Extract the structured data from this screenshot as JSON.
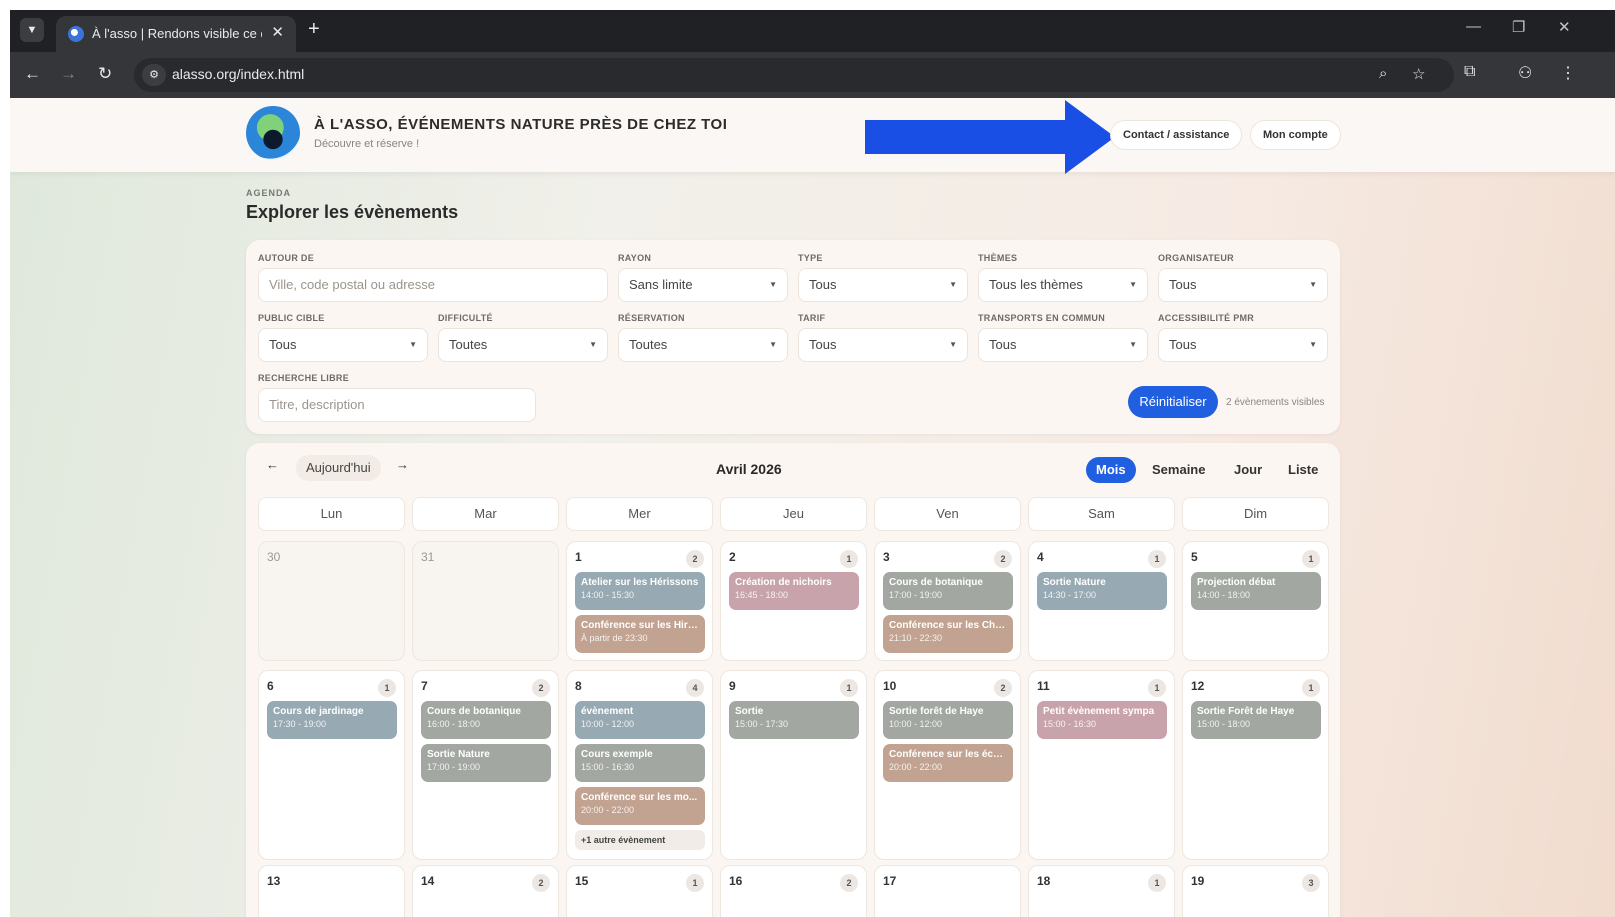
{
  "browser": {
    "tab_title": "À l'asso | Rendons visible ce qu",
    "url": "alasso.org/index.html"
  },
  "site": {
    "title": "À L'ASSO, ÉVÉNEMENTS NATURE PRÈS DE CHEZ TOI",
    "subtitle": "Découvre et réserve !",
    "contact_label": "Contact / assistance",
    "account_label": "Mon compte"
  },
  "agenda": {
    "eyebrow": "AGENDA",
    "title": "Explorer les évènements"
  },
  "filters": {
    "near": {
      "label": "AUTOUR DE",
      "placeholder": "Ville, code postal ou adresse"
    },
    "radius": {
      "label": "RAYON",
      "value": "Sans limite"
    },
    "type": {
      "label": "TYPE",
      "value": "Tous"
    },
    "themes": {
      "label": "THÈMES",
      "value": "Tous les thèmes"
    },
    "organizer": {
      "label": "ORGANISATEUR",
      "value": "Tous"
    },
    "audience": {
      "label": "PUBLIC CIBLE",
      "value": "Tous"
    },
    "difficulty": {
      "label": "DIFFICULTÉ",
      "value": "Toutes"
    },
    "booking": {
      "label": "RÉSERVATION",
      "value": "Toutes"
    },
    "price": {
      "label": "TARIF",
      "value": "Tous"
    },
    "transport": {
      "label": "TRANSPORTS EN COMMUN",
      "value": "Tous"
    },
    "accessibility": {
      "label": "ACCESSIBILITÉ PMR",
      "value": "Tous"
    },
    "search": {
      "label": "RECHERCHE LIBRE",
      "placeholder": "Titre, description"
    },
    "reset_label": "Réinitialiser",
    "visible_count": "2 évènements visibles"
  },
  "calendar": {
    "today_label": "Aujourd'hui",
    "prev_label": "←",
    "next_label": "→",
    "title": "Avril 2026",
    "views": [
      "Mois",
      "Semaine",
      "Jour",
      "Liste"
    ],
    "active_view": "Mois",
    "weekdays": [
      "Lun",
      "Mar",
      "Mer",
      "Jeu",
      "Ven",
      "Sam",
      "Dim"
    ],
    "colors": {
      "blue": "#97a9b2",
      "grey": "#a3a7a2",
      "pink": "#c9a3ab",
      "tan": "#c2a391",
      "reset": "#1f5fe0"
    },
    "weeks": [
      [
        {
          "num": "30",
          "muted": true,
          "events": []
        },
        {
          "num": "31",
          "muted": true,
          "events": []
        },
        {
          "num": "1",
          "count": "2",
          "events": [
            {
              "title": "Atelier sur les Hérissons",
              "time": "14:00 - 15:30",
              "color": "blue"
            },
            {
              "title": "Conférence sur les Hiro...",
              "time": "À partir de 23:30",
              "color": "tan"
            }
          ]
        },
        {
          "num": "2",
          "count": "1",
          "events": [
            {
              "title": "Création de nichoirs",
              "time": "16:45 - 18:00",
              "color": "pink"
            }
          ]
        },
        {
          "num": "3",
          "count": "2",
          "events": [
            {
              "title": "Cours de botanique",
              "time": "17:00 - 19:00",
              "color": "grey"
            },
            {
              "title": "Conférence sur les Cho...",
              "time": "21:10 - 22:30",
              "color": "tan"
            }
          ]
        },
        {
          "num": "4",
          "count": "1",
          "events": [
            {
              "title": "Sortie Nature",
              "time": "14:30 - 17:00",
              "color": "blue"
            }
          ]
        },
        {
          "num": "5",
          "count": "1",
          "events": [
            {
              "title": "Projection débat",
              "time": "14:00 - 18:00",
              "color": "grey"
            }
          ]
        }
      ],
      [
        {
          "num": "6",
          "count": "1",
          "events": [
            {
              "title": "Cours de jardinage",
              "time": "17:30 - 19:00",
              "color": "blue"
            }
          ]
        },
        {
          "num": "7",
          "count": "2",
          "events": [
            {
              "title": "Cours de botanique",
              "time": "16:00 - 18:00",
              "color": "grey"
            },
            {
              "title": "Sortie Nature",
              "time": "17:00 - 19:00",
              "color": "grey"
            }
          ]
        },
        {
          "num": "8",
          "count": "4",
          "more": "+1 autre évènement",
          "events": [
            {
              "title": "évènement",
              "time": "10:00 - 12:00",
              "color": "blue"
            },
            {
              "title": "Cours exemple",
              "time": "15:00 - 16:30",
              "color": "grey"
            },
            {
              "title": "Conférence sur les mo...",
              "time": "20:00 - 22:00",
              "color": "tan"
            }
          ]
        },
        {
          "num": "9",
          "count": "1",
          "events": [
            {
              "title": "Sortie",
              "time": "15:00 - 17:30",
              "color": "grey"
            }
          ]
        },
        {
          "num": "10",
          "count": "2",
          "events": [
            {
              "title": "Sortie forêt de Haye",
              "time": "10:00 - 12:00",
              "color": "grey"
            },
            {
              "title": "Conférence sur les écu...",
              "time": "20:00 - 22:00",
              "color": "tan"
            }
          ]
        },
        {
          "num": "11",
          "count": "1",
          "events": [
            {
              "title": "Petit évènement sympa",
              "time": "15:00 - 16:30",
              "color": "pink"
            }
          ]
        },
        {
          "num": "12",
          "count": "1",
          "events": [
            {
              "title": "Sortie Forêt de Haye",
              "time": "15:00 - 18:00",
              "color": "grey"
            }
          ]
        }
      ],
      [
        {
          "num": "13",
          "events": []
        },
        {
          "num": "14",
          "count": "2",
          "events": []
        },
        {
          "num": "15",
          "count": "1",
          "events": []
        },
        {
          "num": "16",
          "count": "2",
          "events": []
        },
        {
          "num": "17",
          "events": []
        },
        {
          "num": "18",
          "count": "1",
          "events": []
        },
        {
          "num": "19",
          "count": "3",
          "events": []
        }
      ]
    ]
  }
}
